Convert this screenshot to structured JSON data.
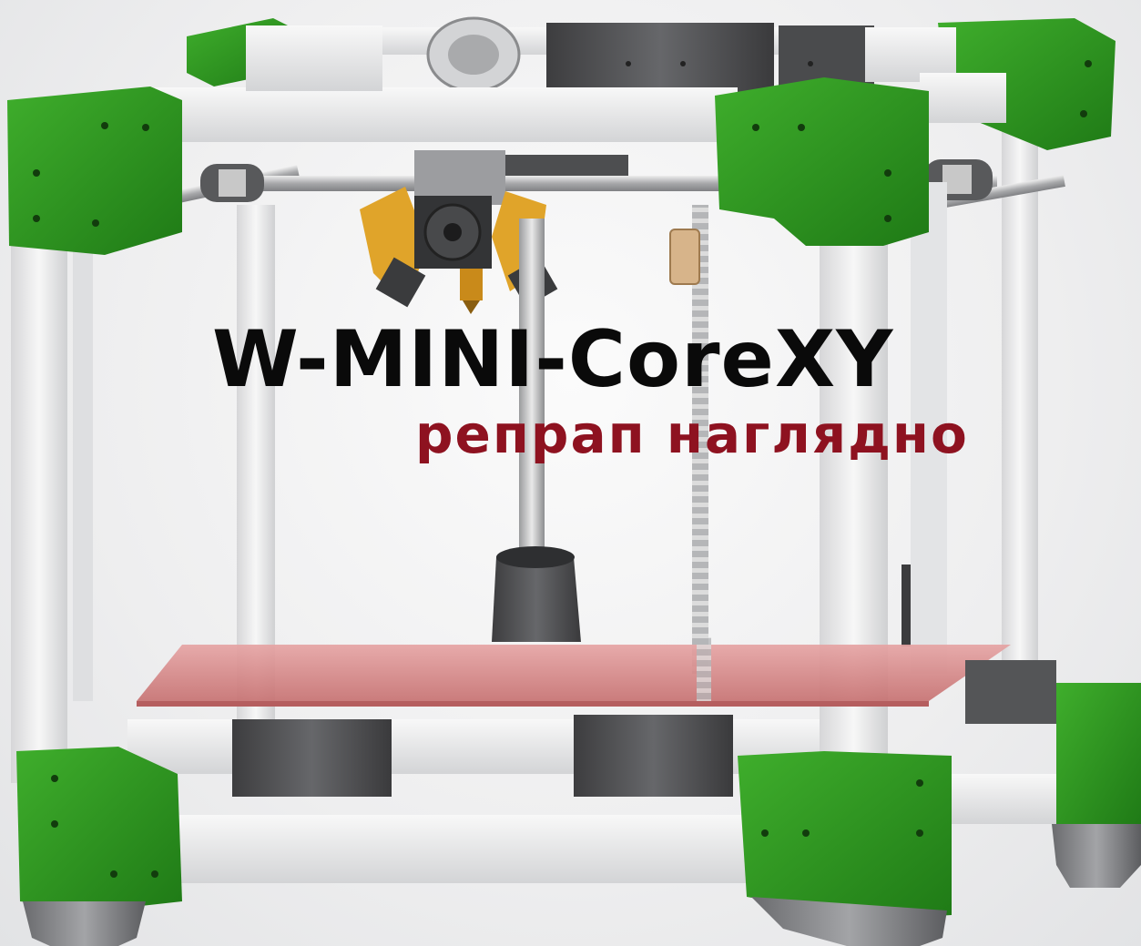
{
  "title": "W-MINI-CoreXY",
  "subtitle": "репрап наглядно",
  "colors": {
    "title": "#0a0a0a",
    "subtitle": "#8e1220",
    "frame_profile": "#eeeeee",
    "corner_brackets": "#2f8f1f",
    "dark_parts": "#555555",
    "print_bed": "#d9898a",
    "hotend_mount": "#e0a42a"
  },
  "icons": {
    "printer": "corexy-3d-printer-render"
  }
}
